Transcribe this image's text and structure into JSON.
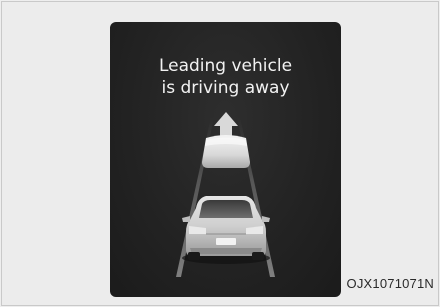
{
  "message": {
    "line1": "Leading vehicle",
    "line2": "is driving away"
  },
  "figure_code": "OJX1071071N",
  "icons": {
    "arrow": "up-arrow-icon",
    "leading_vehicle": "leading-vehicle-icon",
    "own_vehicle": "own-vehicle-icon"
  },
  "colors": {
    "display_background": "#222222",
    "text": "#f2f2f2",
    "page_background": "#ececec"
  }
}
